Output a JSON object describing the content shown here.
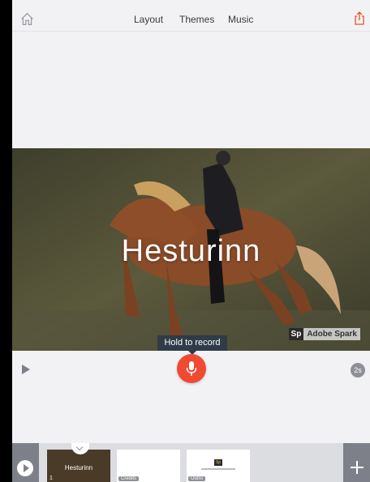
{
  "topbar": {
    "home_icon": "home-icon",
    "tabs": [
      {
        "label": "Layout"
      },
      {
        "label": "Themes"
      },
      {
        "label": "Music"
      }
    ],
    "share_icon": "share-icon",
    "share_color": "#e8502f"
  },
  "slide": {
    "title": "Hesturinn",
    "watermark_logo": "Sp",
    "watermark_text": "Adobe Spark"
  },
  "recorder": {
    "tooltip": "Hold to record",
    "mic_icon": "microphone-icon",
    "mic_color": "#f04a33",
    "play_icon": "play-icon",
    "duration": "2s"
  },
  "filmstrip": {
    "play_icon": "play-circle-icon",
    "thumbnails": [
      {
        "title": "Hesturinn",
        "number": "1"
      },
      {
        "label": "Credits"
      },
      {
        "label": "Outro",
        "logo": "Sp"
      }
    ],
    "add_icon": "plus-icon"
  }
}
